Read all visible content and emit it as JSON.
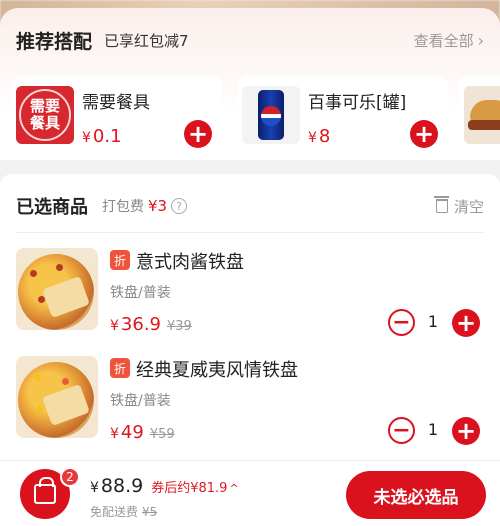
{
  "recommend": {
    "title": "推荐搭配",
    "subtitle": "已享红包减7",
    "see_all": "查看全部",
    "items": [
      {
        "name": "需要餐具",
        "thumb_text_line1": "需要",
        "thumb_text_line2": "餐具",
        "currency": "¥",
        "price": "0.1"
      },
      {
        "name": "百事可乐[罐]",
        "currency": "¥",
        "price": "8"
      }
    ]
  },
  "selected": {
    "title": "已选商品",
    "packing_label": "打包费",
    "packing_fee": "¥3",
    "help_icon_text": "?",
    "clear_label": "清空",
    "items": [
      {
        "tag": "折",
        "name": "意式肉酱铁盘",
        "spec": "铁盘/普装",
        "currency": "¥",
        "price": "36.9",
        "original_price": "¥39",
        "qty": "1"
      },
      {
        "tag": "折",
        "name": "经典夏威夷风情铁盘",
        "spec": "铁盘/普装",
        "currency": "¥",
        "price": "49",
        "original_price": "¥59",
        "qty": "1"
      }
    ]
  },
  "footer": {
    "cart_count": "2",
    "currency": "¥",
    "total": "88.9",
    "after_coupon": "券后约¥81.9",
    "caret": "^",
    "free_shipping_label": "免配送费",
    "original_shipping": "¥5",
    "cta_label": "未选必选品"
  },
  "icons": {
    "plus": "+",
    "minus": "−",
    "chevron_right": "›"
  },
  "colors": {
    "accent": "#d9121d",
    "price": "#e0161e",
    "muted": "#999999"
  }
}
